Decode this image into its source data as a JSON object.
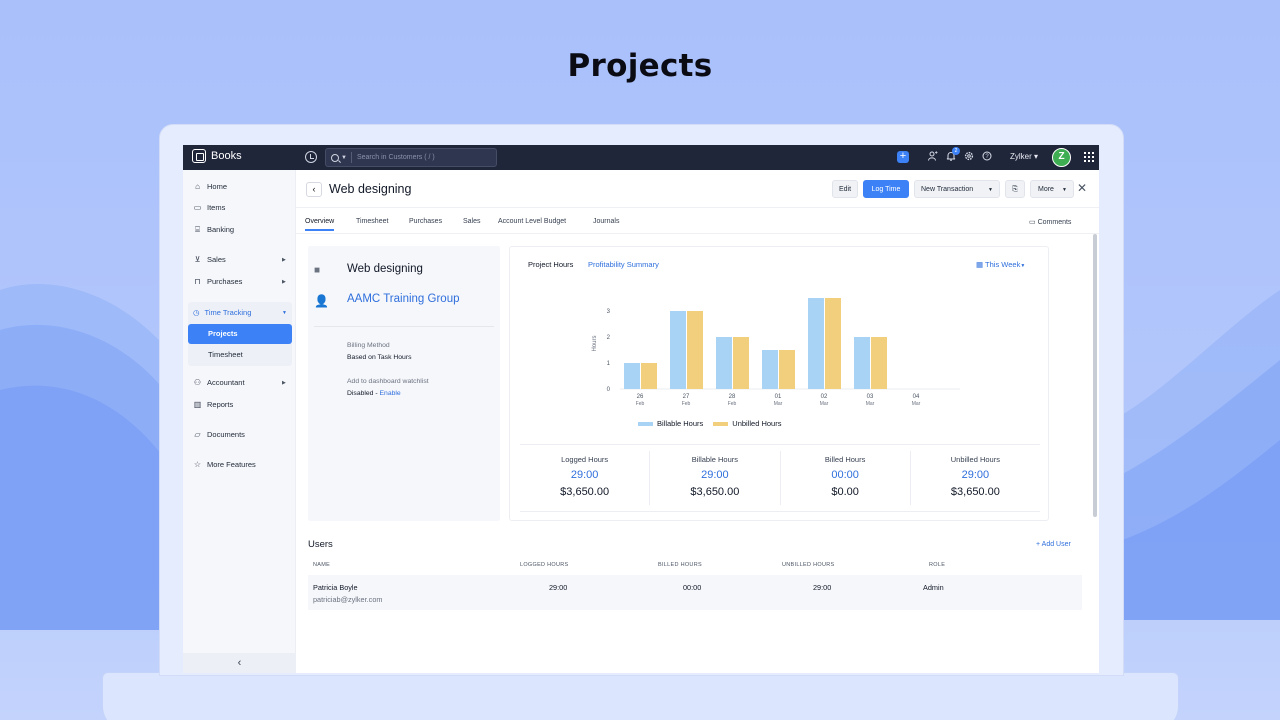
{
  "hero": {
    "title": "Projects"
  },
  "topbar": {
    "brand": "Books",
    "search_placeholder": "Search in Customers ( / )",
    "notification_count": "2",
    "org_name": "Zylker",
    "avatar_letter": "Z"
  },
  "sidebar": {
    "items": {
      "home": "Home",
      "items": "Items",
      "banking": "Banking",
      "sales": "Sales",
      "purchases": "Purchases",
      "time_tracking": "Time Tracking",
      "projects": "Projects",
      "timesheet": "Timesheet",
      "accountant": "Accountant",
      "reports": "Reports",
      "documents": "Documents",
      "more_features": "More Features"
    },
    "collapse_glyph": "‹"
  },
  "header": {
    "title": "Web designing",
    "edit": "Edit",
    "log_time": "Log Time",
    "new_transaction": "New Transaction",
    "more": "More"
  },
  "tabs": {
    "overview": "Overview",
    "timesheet": "Timesheet",
    "purchases": "Purchases",
    "sales": "Sales",
    "account_level_budget": "Account Level Budget",
    "journals": "Journals",
    "comments": "Comments"
  },
  "project_info": {
    "name": "Web designing",
    "customer": "AAMC Training Group",
    "billing_method_label": "Billing Method",
    "billing_method_value": "Based on Task Hours",
    "watchlist_label": "Add to dashboard watchlist",
    "watchlist_value": "Disabled",
    "watchlist_separator": " - ",
    "watchlist_action": "Enable"
  },
  "chart_panel": {
    "tab_hours": "Project Hours",
    "tab_profitability": "Profitability Summary",
    "range": "This Week"
  },
  "chart_data": {
    "type": "bar",
    "categories": [
      {
        "day": "26",
        "month": "Feb"
      },
      {
        "day": "27",
        "month": "Feb"
      },
      {
        "day": "28",
        "month": "Feb"
      },
      {
        "day": "01",
        "month": "Mar"
      },
      {
        "day": "02",
        "month": "Mar"
      },
      {
        "day": "03",
        "month": "Mar"
      },
      {
        "day": "04",
        "month": "Mar"
      }
    ],
    "series": [
      {
        "name": "Billable Hours",
        "color": "#a9d3f5",
        "values": [
          1,
          3,
          2,
          1.5,
          3.5,
          2,
          0
        ]
      },
      {
        "name": "Unbilled Hours",
        "color": "#f1cf7c",
        "values": [
          1,
          3,
          2,
          1.5,
          3.5,
          2,
          0
        ]
      }
    ],
    "ylabel": "Hours",
    "yticks": [
      0,
      1,
      2,
      3
    ],
    "ylim": [
      0,
      3.5
    ],
    "legend": "bottom",
    "grid": false
  },
  "stats": [
    {
      "label": "Logged Hours",
      "hours": "29:00",
      "amount": "$3,650.00"
    },
    {
      "label": "Billable Hours",
      "hours": "29:00",
      "amount": "$3,650.00"
    },
    {
      "label": "Billed Hours",
      "hours": "00:00",
      "amount": "$0.00"
    },
    {
      "label": "Unbilled Hours",
      "hours": "29:00",
      "amount": "$3,650.00"
    }
  ],
  "users": {
    "title": "Users",
    "add_user": "+ Add User",
    "columns": {
      "name": "NAME",
      "logged": "LOGGED HOURS",
      "billed": "BILLED HOURS",
      "unbilled": "UNBILLED HOURS",
      "role": "ROLE"
    },
    "rows": [
      {
        "name": "Patricia Boyle",
        "email": "patriciab@zylker.com",
        "logged": "29:00",
        "billed": "00:00",
        "unbilled": "29:00",
        "role": "Admin"
      }
    ]
  }
}
